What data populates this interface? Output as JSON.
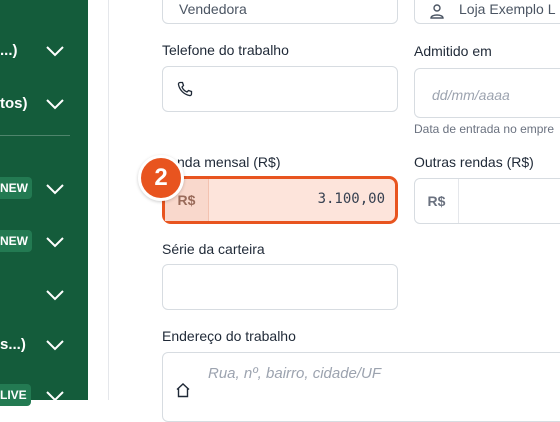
{
  "sidebar": {
    "items": [
      {
        "label": "...)",
        "badge": ""
      },
      {
        "label": "tos)",
        "badge": ""
      },
      {
        "label": "",
        "badge": "NEW"
      },
      {
        "label": "",
        "badge": "NEW"
      },
      {
        "label": "",
        "badge": ""
      },
      {
        "label": "s...)",
        "badge": ""
      },
      {
        "label": "",
        "badge": "LIVE"
      }
    ]
  },
  "form": {
    "cargo": {
      "value": "Vendedora"
    },
    "loja": {
      "value": "Loja Exemplo L"
    },
    "telefone_trabalho": {
      "label": "Telefone do trabalho",
      "value": ""
    },
    "admitido_em": {
      "label": "Admitido em",
      "placeholder": "dd/mm/aaaa",
      "hint": "Data de entrada no empre"
    },
    "renda_mensal": {
      "label": "nda mensal (R$)",
      "prefix": "R$",
      "value": "3.100,00"
    },
    "outras_rendas": {
      "label": "Outras rendas (R$)",
      "prefix": "R$",
      "value": ""
    },
    "serie_carteira": {
      "label": "Série da carteira",
      "value": ""
    },
    "endereco_trabalho": {
      "label": "Endereço do trabalho",
      "placeholder": "Rua, nº, bairro, cidade/UF"
    }
  },
  "step": {
    "number": "2"
  },
  "icons": {
    "phone": "phone-icon",
    "house": "house-icon",
    "user": "user-icon",
    "chevron": "chevron-down-icon"
  },
  "colors": {
    "sidebar_bg": "#145c3b",
    "accent": "#e8541f",
    "highlight_fill": "#fde4db"
  }
}
